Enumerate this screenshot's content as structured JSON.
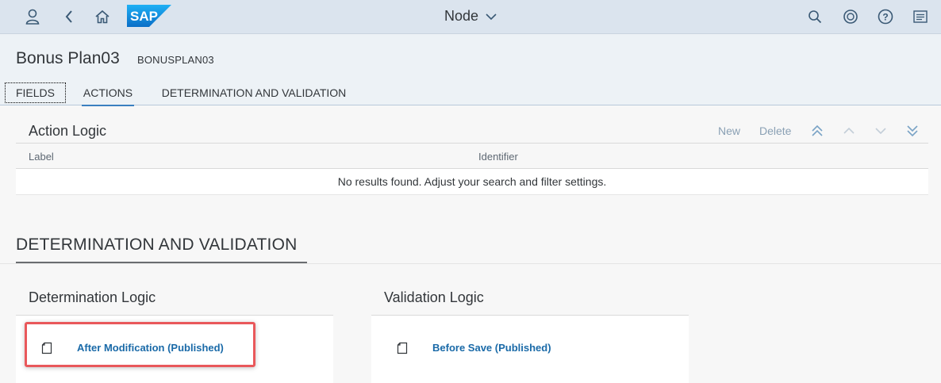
{
  "shell": {
    "title": "Node",
    "icons": [
      "user-icon",
      "back-icon",
      "home-icon",
      "sap-logo",
      "search-icon",
      "copilot-icon",
      "help-icon",
      "menu-icon"
    ],
    "logo_text": "SAP"
  },
  "header": {
    "title": "Bonus Plan03",
    "subtitle": "BONUSPLAN03",
    "tabs": [
      {
        "label": "FIELDS"
      },
      {
        "label": "ACTIONS"
      },
      {
        "label": "DETERMINATION AND VALIDATION"
      }
    ]
  },
  "action_logic": {
    "title": "Action Logic",
    "toolbar": {
      "new_label": "New",
      "delete_label": "Delete"
    },
    "columns": [
      "Label",
      "Identifier"
    ],
    "empty_text": "No results found. Adjust your search and filter settings."
  },
  "det_val": {
    "heading": "DETERMINATION AND VALIDATION",
    "determination": {
      "title": "Determination Logic",
      "items": [
        {
          "label": "After Modification (Published)"
        }
      ]
    },
    "validation": {
      "title": "Validation Logic",
      "items": [
        {
          "label": "Before Save (Published)"
        }
      ]
    }
  },
  "colors": {
    "shell_bg": "#dbe4ee",
    "header_bg": "#edf2f6",
    "link": "#1a6aa8",
    "highlight": "#e9585b",
    "sap_blue": "#1a8fde"
  }
}
